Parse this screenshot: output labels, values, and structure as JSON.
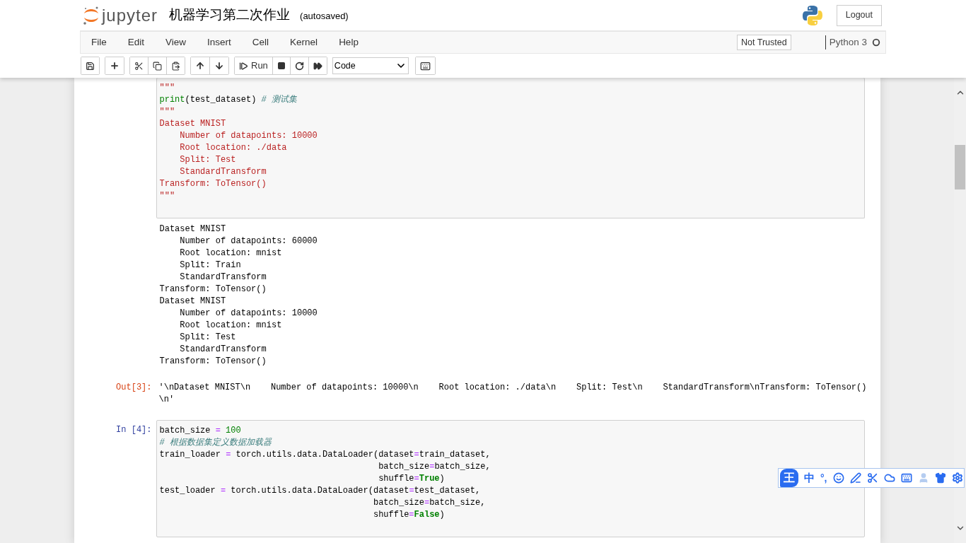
{
  "header": {
    "logo_text": "jupyter",
    "notebook_title": "机器学习第二次作业",
    "save_status": "(autosaved)",
    "logout": "Logout"
  },
  "menu": {
    "items": [
      "File",
      "Edit",
      "View",
      "Insert",
      "Cell",
      "Kernel",
      "Help"
    ],
    "trust_status": "Not Trusted",
    "kernel_name": "Python 3"
  },
  "toolbar": {
    "run_label": "Run",
    "cell_type": "Code"
  },
  "cells": [
    {
      "input": [
        [
          {
            "kind": "string",
            "text": "\"\"\""
          }
        ],
        [
          {
            "kind": "builtin",
            "text": "print"
          },
          {
            "kind": "plain",
            "text": "(test_dataset) "
          },
          {
            "kind": "comment",
            "text": "# 测试集"
          }
        ],
        [
          {
            "kind": "string",
            "text": "\"\"\""
          }
        ],
        [
          {
            "kind": "string",
            "text": "Dataset MNIST"
          }
        ],
        [
          {
            "kind": "string",
            "text": "    Number of datapoints: 10000"
          }
        ],
        [
          {
            "kind": "string",
            "text": "    Root location: ./data"
          }
        ],
        [
          {
            "kind": "string",
            "text": "    Split: Test"
          }
        ],
        [
          {
            "kind": "string",
            "text": "    StandardTransform"
          }
        ],
        [
          {
            "kind": "string",
            "text": "Transform: ToTensor()"
          }
        ],
        [
          {
            "kind": "string",
            "text": "\"\"\""
          }
        ]
      ],
      "stream": [
        "Dataset MNIST",
        "    Number of datapoints: 60000",
        "    Root location: mnist",
        "    Split: Train",
        "    StandardTransform",
        "Transform: ToTensor()",
        "Dataset MNIST",
        "    Number of datapoints: 10000",
        "    Root location: mnist",
        "    Split: Test",
        "    StandardTransform",
        "Transform: ToTensor()"
      ],
      "out_prompt": "Out[3]:",
      "result": [
        "'\\nDataset MNIST\\n    Number of datapoints: 10000\\n    Root location: ./data\\n    Split: Test\\n    StandardTransform\\nTransform: ToTensor()",
        "\\n'"
      ]
    },
    {
      "prompt": "In [4]:",
      "input": [
        [
          {
            "kind": "plain",
            "text": "batch_size "
          },
          {
            "kind": "operator",
            "text": "="
          },
          {
            "kind": "number",
            "text": " 100"
          }
        ],
        [
          {
            "kind": "comment",
            "text": "# 根据数据集定义数据加载器"
          }
        ],
        [
          {
            "kind": "plain",
            "text": "train_loader "
          },
          {
            "kind": "operator",
            "text": "="
          },
          {
            "kind": "plain",
            "text": " torch.utils.data.DataLoader(dataset"
          },
          {
            "kind": "operator",
            "text": "="
          },
          {
            "kind": "plain",
            "text": "train_dataset,"
          }
        ],
        [
          {
            "kind": "plain",
            "text": "                                           batch_size"
          },
          {
            "kind": "operator",
            "text": "="
          },
          {
            "kind": "plain",
            "text": "batch_size,"
          }
        ],
        [
          {
            "kind": "plain",
            "text": "                                           shuffle"
          },
          {
            "kind": "operator",
            "text": "="
          },
          {
            "kind": "bool",
            "text": "True"
          },
          {
            "kind": "plain",
            "text": ")"
          }
        ],
        [
          {
            "kind": "plain",
            "text": "test_loader "
          },
          {
            "kind": "operator",
            "text": "="
          },
          {
            "kind": "plain",
            "text": " torch.utils.data.DataLoader(dataset"
          },
          {
            "kind": "operator",
            "text": "="
          },
          {
            "kind": "plain",
            "text": "test_dataset,"
          }
        ],
        [
          {
            "kind": "plain",
            "text": "                                          batch_size"
          },
          {
            "kind": "operator",
            "text": "="
          },
          {
            "kind": "plain",
            "text": "batch_size,"
          }
        ],
        [
          {
            "kind": "plain",
            "text": "                                          shuffle"
          },
          {
            "kind": "operator",
            "text": "="
          },
          {
            "kind": "bool",
            "text": "False"
          },
          {
            "kind": "plain",
            "text": ")"
          }
        ]
      ]
    }
  ],
  "ime_toolbar": {
    "logo": "王",
    "mode": "中",
    "punctuation": "°,"
  }
}
